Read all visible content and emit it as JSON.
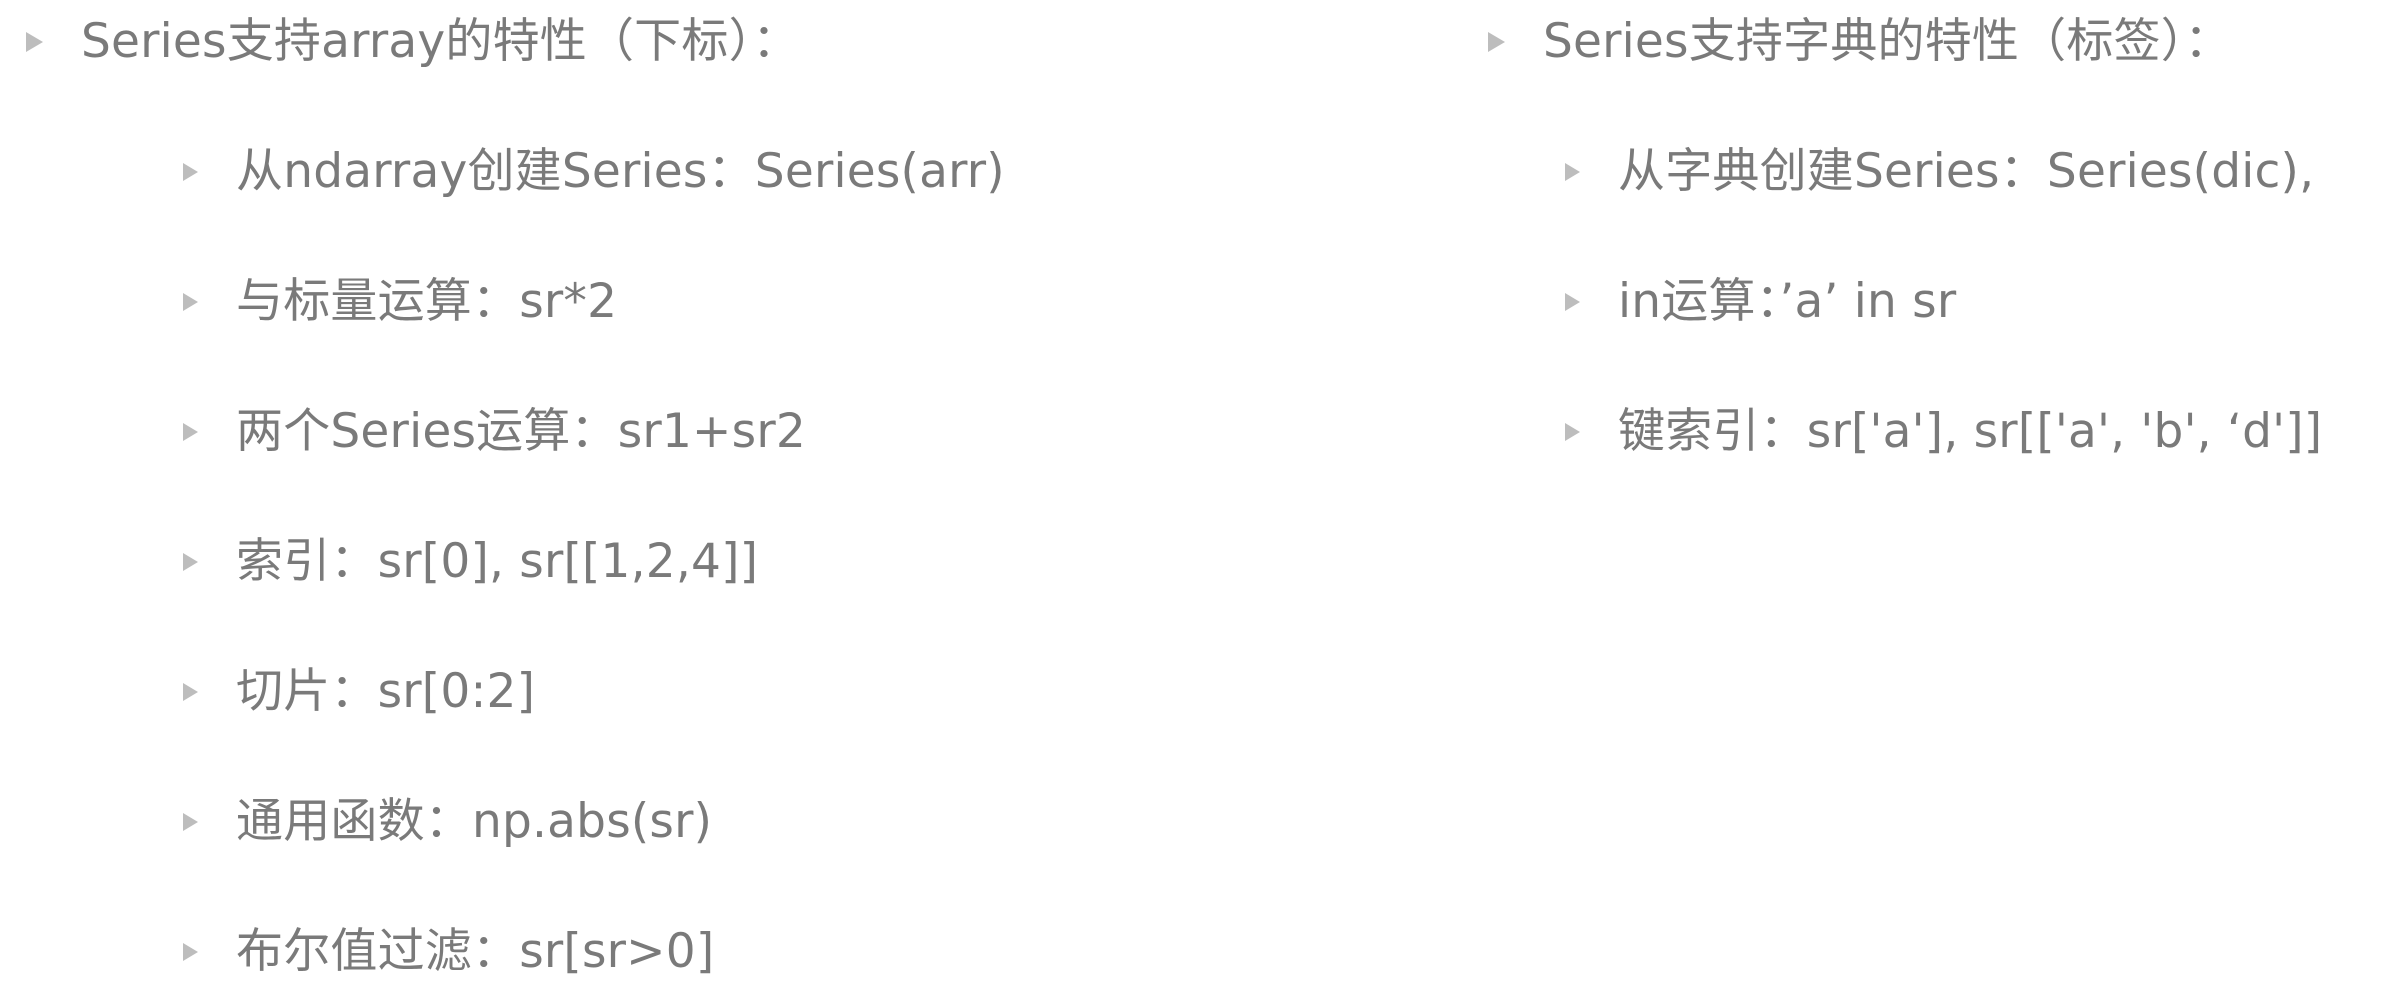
{
  "left": {
    "heading": "Series支持array的特性（下标）：",
    "items": [
      "从ndarray创建Series：Series(arr)",
      "与标量运算：sr*2",
      "两个Series运算：sr1+sr2",
      "索引：sr[0], sr[[1,2,4]]",
      "切片：sr[0:2]",
      "通用函数：np.abs(sr)",
      "布尔值过滤：sr[sr>0]"
    ]
  },
  "right": {
    "heading": "Series支持字典的特性（标签）：",
    "items": [
      "从字典创建Series：Series(dic),",
      "in运算：’a’ in sr",
      "键索引：sr['a'], sr[['a', 'b', ‘d']]"
    ]
  },
  "colors": {
    "text": "#7a7a7a",
    "bullet": "#bdbdbd"
  },
  "icons": {
    "bullet": "triangle-bullet-icon"
  }
}
